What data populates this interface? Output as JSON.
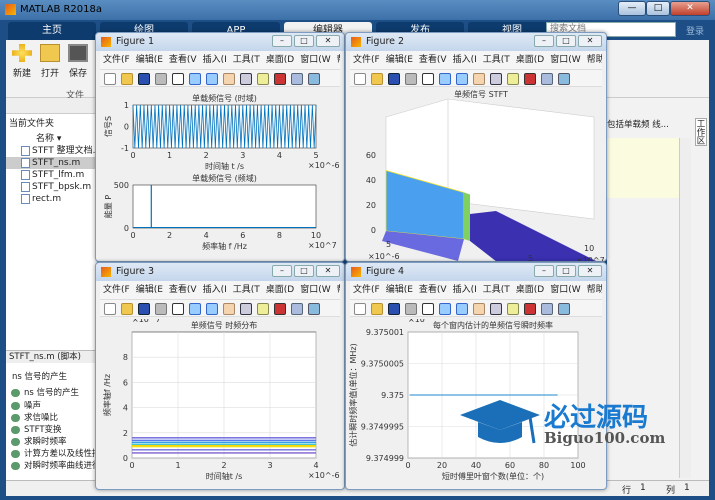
{
  "app": {
    "title": "MATLAB R2018a",
    "win_min": "—",
    "win_max": "□",
    "win_close": "✕"
  },
  "tabs": [
    "主页",
    "绘图",
    "APP",
    "编辑器",
    "发布",
    "视图"
  ],
  "toolstrip": {
    "buttons": [
      "新建",
      "打开",
      "保存"
    ],
    "group": "文件",
    "search_placeholder": "搜索文档",
    "login": "登录"
  },
  "browser": {
    "header": "当前文件夹",
    "col": "名称 ▾",
    "files": [
      "STFT 整理文档.docx",
      "STFT_ns.m",
      "STFT_lfm.m",
      "STFT_bpsk.m",
      "rect.m"
    ]
  },
  "details": {
    "title": "STFT_ns.m  (脚本)",
    "heading": "ns 信号的产生",
    "items": [
      "ns 信号的产生",
      "噪声",
      "求信噪比",
      "STFT变换",
      "求瞬时频率",
      "计算方差以及线性拟合",
      "对瞬时频率曲线进行"
    ]
  },
  "right": {
    "hint": "包括单载频 线...",
    "side_tab": "工作区"
  },
  "status": {
    "row_label": "行",
    "row": "1",
    "col_label": "列",
    "col": "1"
  },
  "figure_menu": [
    "文件(F",
    "编辑(E",
    "查看(V",
    "插入(I",
    "工具(T",
    "桌面(D",
    "窗口(W",
    "帮助(H"
  ],
  "figures": [
    {
      "title": "Figure 1"
    },
    {
      "title": "Figure 2"
    },
    {
      "title": "Figure 3"
    },
    {
      "title": "Figure 4"
    }
  ],
  "watermark": {
    "cn": "必过源码",
    "en": "Biguo100.com"
  },
  "chart_data": [
    {
      "type": "line",
      "title": "单载频信号 (时域)",
      "xlabel": "时间轴 t /s",
      "ylabel": "信号S",
      "xlim": [
        0,
        5
      ],
      "x_exponent": "×10^-6",
      "ylim": [
        -1,
        1
      ],
      "xticks": [
        "0",
        "1",
        "2",
        "3",
        "4",
        "5"
      ],
      "yticks": [
        "-1",
        "0",
        "1"
      ],
      "cycles": 50,
      "color": "#0072bd"
    },
    {
      "type": "line",
      "title": "单载频信号 (频域)",
      "xlabel": "频率轴 f /Hz",
      "ylabel": "能量 P",
      "xlim": [
        0,
        10
      ],
      "x_exponent": "×10^7",
      "ylim": [
        0,
        500
      ],
      "xticks": [
        "0",
        "2",
        "4",
        "6",
        "8",
        "10"
      ],
      "yticks": [
        "0",
        "500"
      ],
      "spike_x": 1,
      "spike_y": 500,
      "color": "#0072bd"
    },
    {
      "type": "surface",
      "title": "单频信号 STFT",
      "xlabel": "频率轴f /Hz",
      "ylabel": "时间轴t /s",
      "zlim": [
        0,
        60
      ],
      "zticks": [
        "0",
        "20",
        "40",
        "60"
      ],
      "xticks": [
        "0",
        "5",
        "10"
      ],
      "x_exponent": "×10^7",
      "yticks": [
        "0",
        "5"
      ],
      "y_exponent": "×10^-6",
      "peak": 50,
      "peak_freq": 1
    },
    {
      "type": "line",
      "title": "单频信号 时频分布",
      "xlabel": "时间轴t /s",
      "ylabel": "频率轴f /Hz",
      "xlim": [
        0,
        5
      ],
      "x_exponent": "×10^-6",
      "ylim": [
        0,
        10
      ],
      "y_exponent": "×10^7",
      "xticks": [
        "0",
        "1",
        "2",
        "3",
        "4"
      ],
      "yticks": [
        "0",
        "2",
        "4",
        "6",
        "8"
      ],
      "grid": true,
      "contour_levels": [
        {
          "y": 0.4,
          "color": "#7e5fd0"
        },
        {
          "y": 0.65,
          "color": "#6f6fe0"
        },
        {
          "y": 0.9,
          "color": "#f0e020"
        },
        {
          "y": 1.0,
          "color": "#f5d800"
        },
        {
          "y": 1.1,
          "color": "#33c0d0"
        },
        {
          "y": 1.25,
          "color": "#3a9ee8"
        },
        {
          "y": 1.4,
          "color": "#5a7ae8"
        },
        {
          "y": 1.6,
          "color": "#6a5fd8"
        }
      ]
    },
    {
      "type": "line",
      "title": "每个窗内估计的单频信号瞬时频率",
      "xlabel": "短时傅里叶窗个数(单位：个)",
      "ylabel": "估计瞬时频率值(单位：MHz)",
      "xlim": [
        0,
        100
      ],
      "ylim": [
        9.374999,
        9.375001
      ],
      "y_exponent": "×10",
      "xticks": [
        "0",
        "20",
        "40",
        "60",
        "80",
        "100"
      ],
      "yticks": [
        "9.374999",
        "9.3749995",
        "9.375",
        "9.3750005",
        "9.375001"
      ],
      "grid": true,
      "series": {
        "x": [
          1,
          88
        ],
        "y": [
          9.375,
          9.375
        ]
      },
      "color": "#4a9fd8"
    }
  ]
}
